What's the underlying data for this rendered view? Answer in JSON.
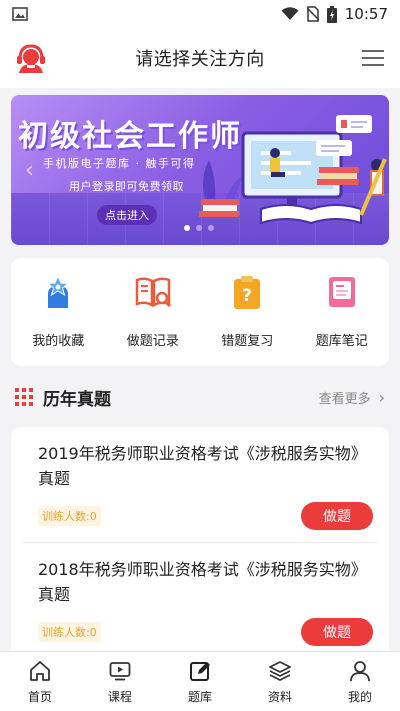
{
  "status_bar": {
    "time": "10:57"
  },
  "header": {
    "title": "请选择关注方向"
  },
  "banner": {
    "title": "初级社会工作师",
    "subtitle": "手机版电子题库 · 触手可得",
    "subtitle2": "用户登录即可免费领取",
    "button_label": "点击进入"
  },
  "quick_actions": [
    {
      "label": "我的收藏",
      "icon": "favorite-star-icon"
    },
    {
      "label": "做题记录",
      "icon": "book-search-icon"
    },
    {
      "label": "错题复习",
      "icon": "question-clipboard-icon"
    },
    {
      "label": "题库笔记",
      "icon": "notebook-icon"
    }
  ],
  "section": {
    "title": "历年真题",
    "more_label": "查看更多"
  },
  "exams": [
    {
      "title": "2019年税务师职业资格考试《涉税服务实物》真题",
      "count": "训练人数:0",
      "button_label": "做题"
    },
    {
      "title": "2018年税务师职业资格考试《涉税服务实物》真题",
      "count": "训练人数:0",
      "button_label": "做题"
    }
  ],
  "bottom_nav": [
    {
      "label": "首页",
      "icon": "home-icon"
    },
    {
      "label": "课程",
      "icon": "video-play-icon"
    },
    {
      "label": "题库",
      "icon": "edit-pen-icon"
    },
    {
      "label": "资料",
      "icon": "layers-icon"
    },
    {
      "label": "我的",
      "icon": "user-icon"
    }
  ],
  "colors": {
    "accent": "#ec3b3b",
    "banner_purple": "#8b5fe3",
    "count_orange": "#e8a13a"
  }
}
